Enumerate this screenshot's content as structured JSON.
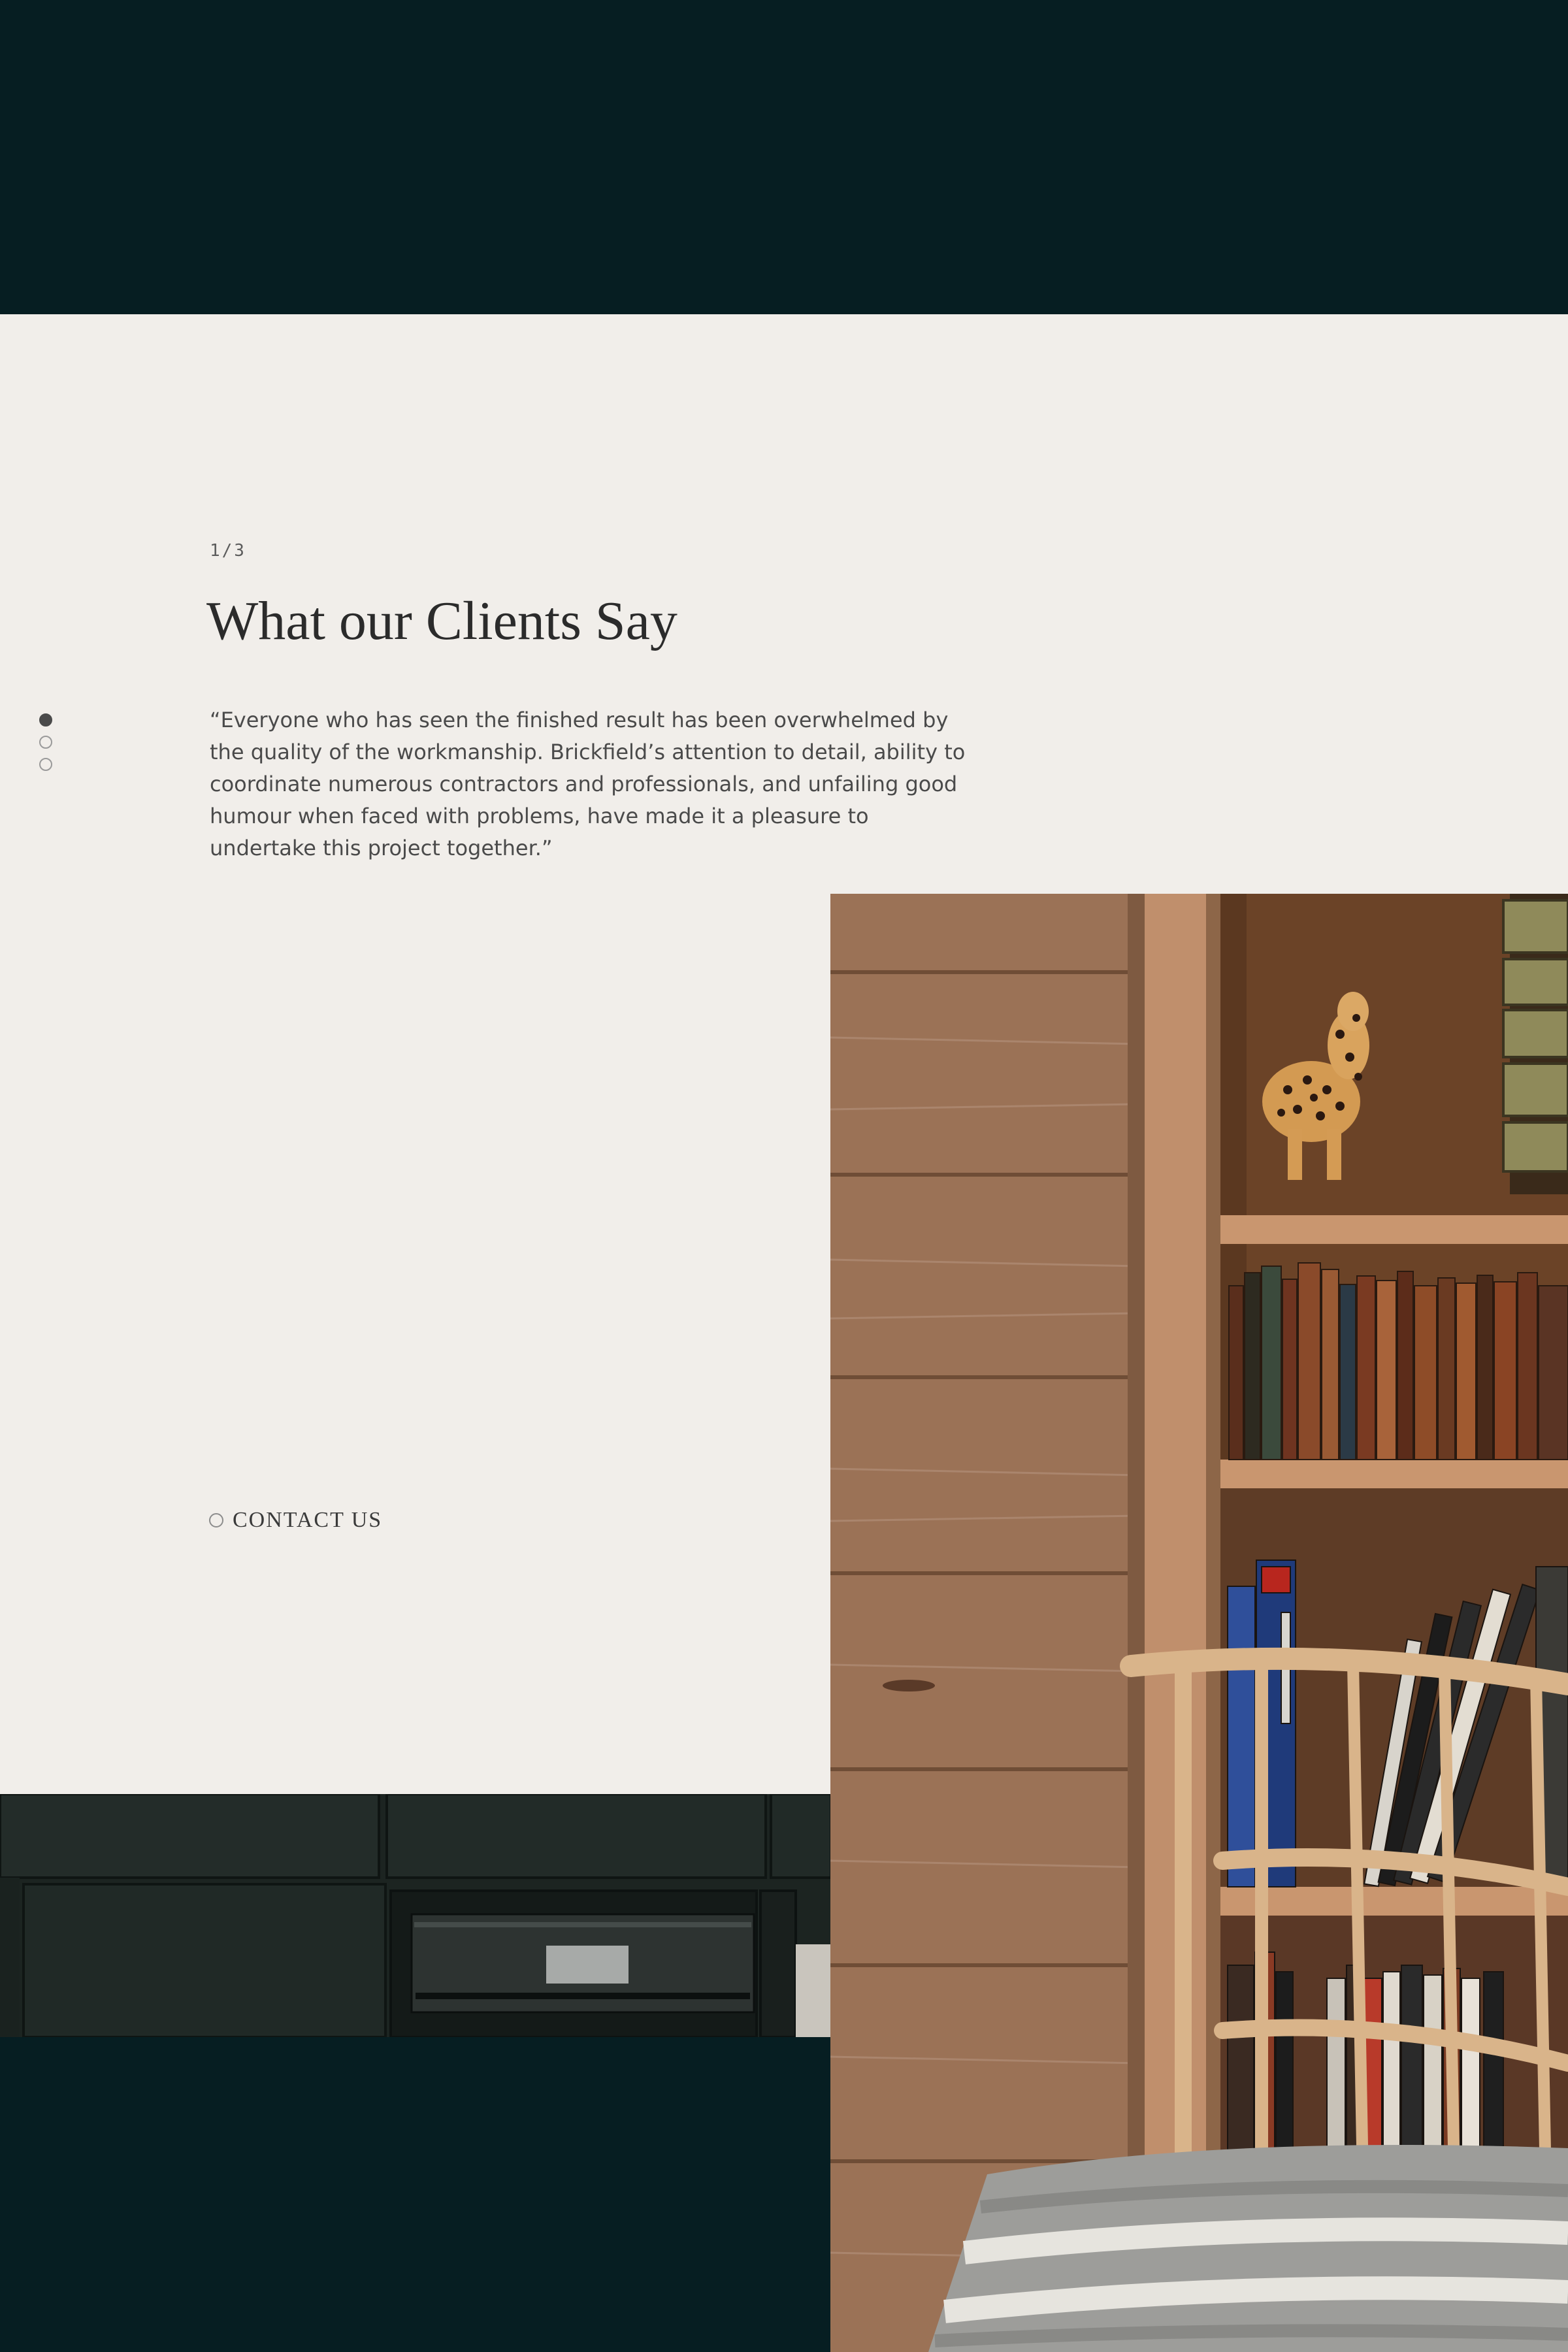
{
  "testimonials": {
    "counter": "1/3",
    "title": "What our Clients Say",
    "quote": "“Everyone who has seen the finished result has been overwhelmed by the quality of the workmanship. Brickfield’s attention to detail, ability to coordinate numerous contractors and professionals, and unfailing good humour when faced with problems, have made it a pleasure to undertake this project together.”",
    "active_index": 1,
    "total": 3
  },
  "contact": {
    "label": "CONTACT US"
  },
  "images": {
    "kitchen": "kitchen-cabinets-photo",
    "library": "wood-panelling-bookshelf-chair-photo"
  },
  "colors": {
    "dark_band": "#061e22",
    "section_bg": "#f1eeea",
    "text": "#2b2b2b"
  }
}
